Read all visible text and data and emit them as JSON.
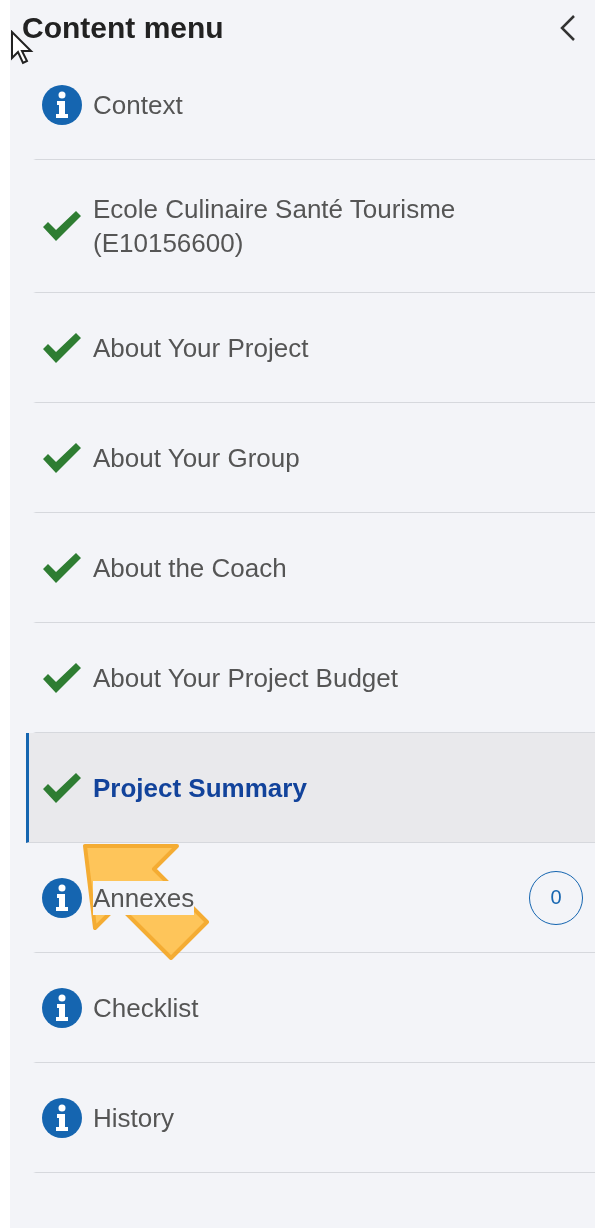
{
  "panel": {
    "title": "Content menu"
  },
  "items": [
    {
      "label": "Context",
      "kind": "info",
      "selected": false
    },
    {
      "label": "Ecole Culinaire Santé Tourisme (E10156600)",
      "kind": "done",
      "selected": false
    },
    {
      "label": "About Your Project",
      "kind": "done",
      "selected": false
    },
    {
      "label": "About Your Group",
      "kind": "done",
      "selected": false
    },
    {
      "label": "About the Coach",
      "kind": "done",
      "selected": false
    },
    {
      "label": "About Your Project Budget",
      "kind": "done",
      "selected": false
    },
    {
      "label": "Project Summary",
      "kind": "done",
      "selected": true
    },
    {
      "label": "Annexes",
      "kind": "info",
      "selected": false,
      "badge": "0"
    },
    {
      "label": "Checklist",
      "kind": "info",
      "selected": false
    },
    {
      "label": "History",
      "kind": "info",
      "selected": false
    }
  ]
}
